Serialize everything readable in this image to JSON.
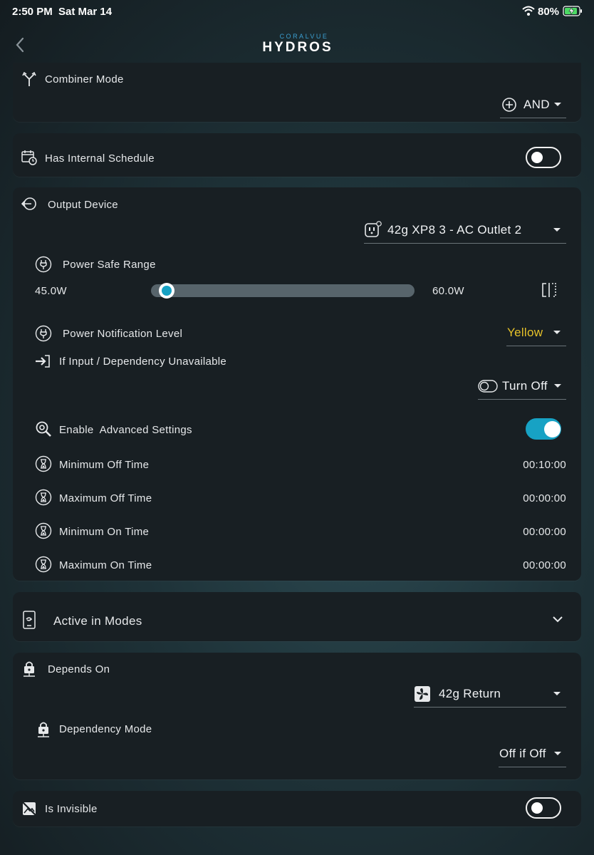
{
  "status_bar": {
    "time": "2:50 PM",
    "date": "Sat Mar 14",
    "battery": "80%"
  },
  "header": {
    "brand_small": "CORALVUE",
    "brand": "HYDROS",
    "icons": {
      "back": "chevron-left-icon"
    }
  },
  "combiner": {
    "label": "Combiner Mode",
    "value": "AND",
    "icon": "fork-arrows-icon"
  },
  "schedule": {
    "label": "Has Internal Schedule",
    "enabled": false,
    "icon": "calendar-clock-icon"
  },
  "output": {
    "label": "Output Device",
    "device": "42g XP8 3 - AC Outlet 2",
    "power_safe_range": {
      "label": "Power Safe Range",
      "min_label": "45.0W",
      "max_label": "60.0W"
    },
    "notification": {
      "label": "Power Notification Level",
      "value": "Yellow",
      "value_color": "#e6c229"
    },
    "unavailable": {
      "label": "If Input / Dependency Unavailable",
      "value": "Turn Off"
    },
    "advanced": {
      "label": "Enable  Advanced Settings",
      "enabled": true
    },
    "timers": [
      {
        "label": "Minimum Off Time",
        "value": "00:10:00"
      },
      {
        "label": "Maximum Off Time",
        "value": "00:00:00"
      },
      {
        "label": "Minimum On Time",
        "value": "00:00:00"
      },
      {
        "label": "Maximum On Time",
        "value": "00:00:00"
      }
    ]
  },
  "modes": {
    "label": "Active in Modes"
  },
  "depends": {
    "label": "Depends On",
    "value": "42g Return",
    "mode_label": "Dependency Mode",
    "mode_value": "Off if Off"
  },
  "invisible": {
    "label": "Is Invisible",
    "enabled": false
  },
  "colors": {
    "accent": "#17a2c4",
    "card": "#181f23",
    "warning": "#e6c229"
  }
}
